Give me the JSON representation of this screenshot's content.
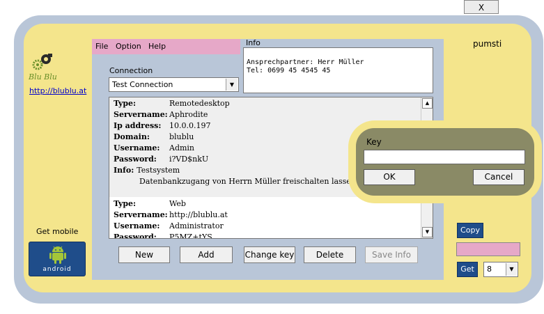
{
  "window": {
    "close_label": "X"
  },
  "sidebar": {
    "logo_text": "Blu Blu",
    "website": "http://blublu.at",
    "get_mobile": "Get mobile",
    "android_label": "android"
  },
  "menu": {
    "items": [
      "File",
      "Option",
      "Help"
    ]
  },
  "info": {
    "label": "Info",
    "lines": [
      "Ansprechpartner: Herr Müller",
      "Tel: 0699 45 4545 45"
    ]
  },
  "connection": {
    "label": "Connection",
    "selected": "Test Connection"
  },
  "entries": [
    {
      "fields": [
        {
          "label": "Type:",
          "value": "Remotedesktop"
        },
        {
          "label": "Servername:",
          "value": "Aphrodite"
        },
        {
          "label": "Ip address:",
          "value": "10.0.0.197"
        },
        {
          "label": "Domain:",
          "value": "blublu"
        },
        {
          "label": "Username:",
          "value": "Admin"
        },
        {
          "label": "Password:",
          "value": "i?VD$nkU"
        }
      ],
      "info_label": "Info:",
      "info_lines": [
        "Testsystem",
        "Datenbankzugang von Herrn Müller freischalten lassen."
      ]
    },
    {
      "fields": [
        {
          "label": "Type:",
          "value": "Web"
        },
        {
          "label": "Servername:",
          "value": "http://blublu.at"
        },
        {
          "label": "Username:",
          "value": "Administrator"
        },
        {
          "label": "Password:",
          "value": "P5MZ+tYS"
        }
      ]
    }
  ],
  "buttons": {
    "new": "New",
    "add": "Add",
    "change_key": "Change key",
    "delete": "Delete",
    "save_info": "Save Info"
  },
  "right_panel": {
    "user": "pumsti",
    "copy": "Copy",
    "get": "Get",
    "count_value": "8"
  },
  "key_dialog": {
    "label": "Key",
    "input_value": "",
    "ok": "OK",
    "cancel": "Cancel"
  },
  "colors": {
    "frame": "#b9c6d8",
    "background": "#f4e58c",
    "menu_pink": "#e6a8c8",
    "dialog": "#8a8a66",
    "button_blue": "#1f4d8a"
  }
}
